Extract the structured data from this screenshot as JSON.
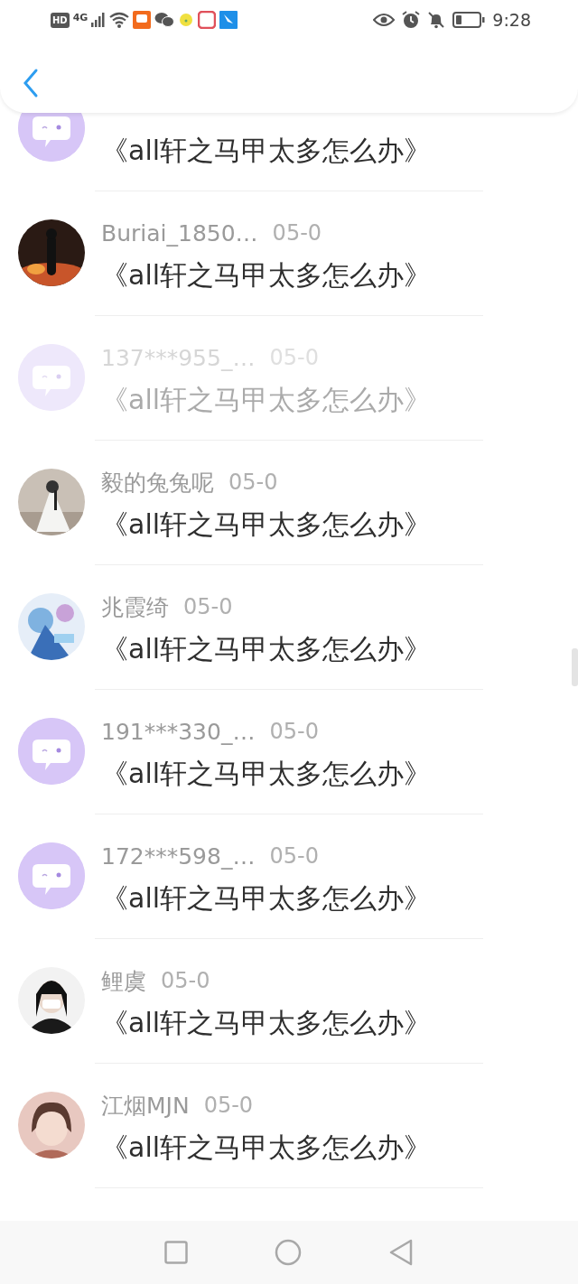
{
  "status_bar": {
    "left_badges": [
      "HD",
      "4G"
    ],
    "time": "9:28"
  },
  "rows": [
    {
      "avatar": {
        "kind": "default"
      },
      "title": "《all轩之马甲太多怎么办》",
      "dimmed": false
    },
    {
      "name": "Buriai_1850…",
      "date": "05-0",
      "title": "《all轩之马甲太多怎么办》",
      "dimmed": false
    },
    {
      "avatar": {
        "kind": "default"
      },
      "name": "137***955_…",
      "date": "05-0",
      "title": "《all轩之马甲太多怎么办》",
      "dimmed": true
    },
    {
      "name": "毅的兔兔呢",
      "date": "05-0",
      "title": "《all轩之马甲太多怎么办》",
      "dimmed": false
    },
    {
      "name": "兆霞绮",
      "date": "05-0",
      "title": "《all轩之马甲太多怎么办》",
      "dimmed": false
    },
    {
      "avatar": {
        "kind": "default"
      },
      "name": "191***330_…",
      "date": "05-0",
      "title": "《all轩之马甲太多怎么办》",
      "dimmed": false
    },
    {
      "avatar": {
        "kind": "default"
      },
      "name": "172***598_…",
      "date": "05-0",
      "title": "《all轩之马甲太多怎么办》",
      "dimmed": false
    },
    {
      "name": "鲤虞",
      "date": "05-0",
      "title": "《all轩之马甲太多怎么办》",
      "dimmed": false
    },
    {
      "name": "江烟MJN",
      "date": "05-0",
      "title": "《all轩之马甲太多怎么办》",
      "dimmed": false
    }
  ]
}
